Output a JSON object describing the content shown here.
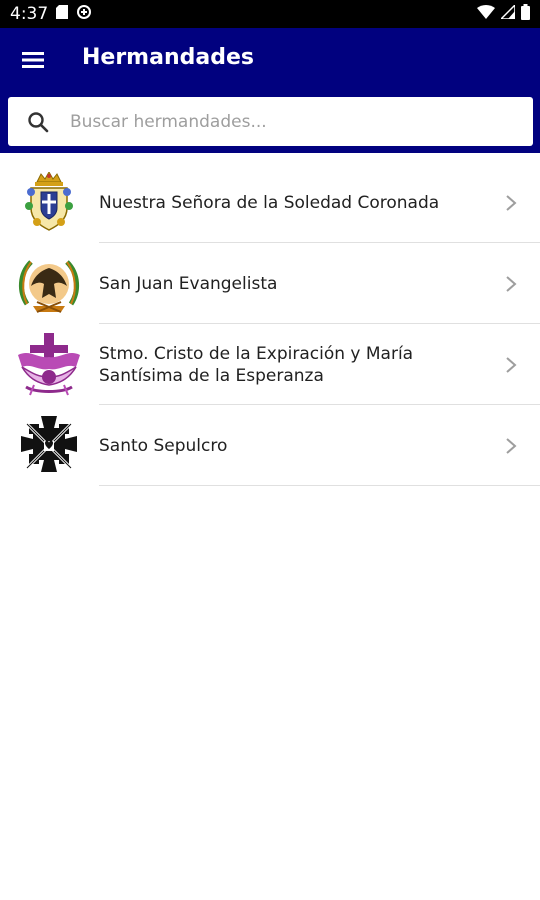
{
  "status_bar": {
    "time": "4:37"
  },
  "app_bar": {
    "title": "Hermandades",
    "color": "#01017f"
  },
  "search": {
    "placeholder": "Buscar hermandades..."
  },
  "list": {
    "items": [
      {
        "label": "Nuestra Señora de la Soledad Coronada",
        "icon": "crown-shield-emblem-icon"
      },
      {
        "label": "San Juan Evangelista",
        "icon": "eagle-laurel-emblem-icon"
      },
      {
        "label": "Stmo. Cristo de la Expiración y María Santísima de la Esperanza",
        "icon": "purple-cross-emblem-icon"
      },
      {
        "label": "Santo Sepulcro",
        "icon": "black-cross-emblem-icon"
      }
    ]
  }
}
